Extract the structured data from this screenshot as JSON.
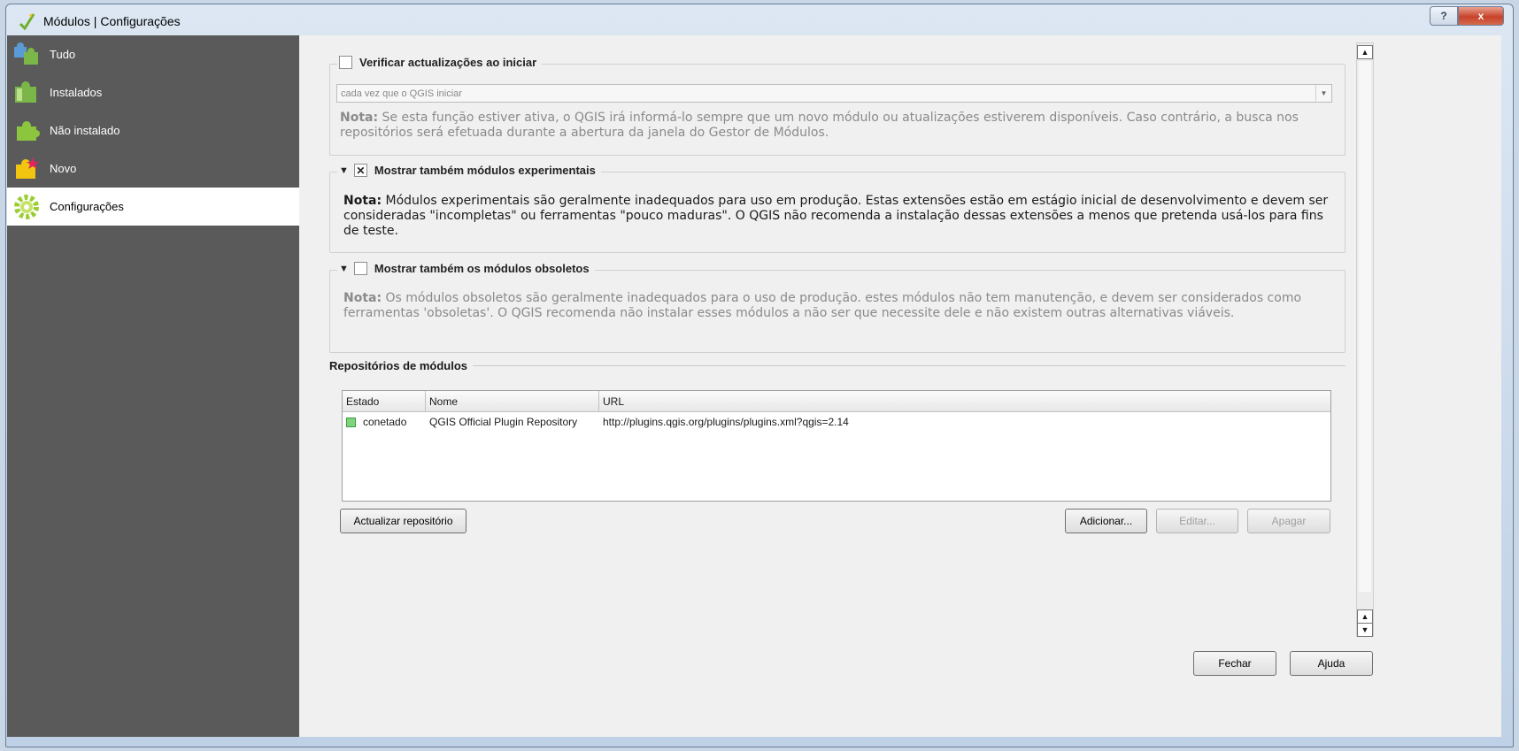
{
  "window": {
    "title": "Módulos | Configurações",
    "help_label": "?",
    "close_label": "x"
  },
  "sidebar": {
    "items": [
      {
        "label": "Tudo",
        "icon": "puzzle-all-icon"
      },
      {
        "label": "Instalados",
        "icon": "puzzle-installed-icon"
      },
      {
        "label": "Não instalado",
        "icon": "puzzle-not-installed-icon"
      },
      {
        "label": "Novo",
        "icon": "puzzle-new-icon"
      },
      {
        "label": "Configurações",
        "icon": "gear-icon",
        "active": true
      }
    ]
  },
  "updates": {
    "checkbox_label": "Verificar actualizações ao iniciar",
    "checked": false,
    "frequency": "cada vez que o QGIS iniciar",
    "note_label": "Nota:",
    "note_text": " Se esta função estiver ativa, o QGIS irá informá-lo sempre que um novo módulo ou atualizações estiverem disponíveis. Caso contrário, a busca nos repositórios será efetuada durante a abertura da janela do Gestor de Módulos."
  },
  "experimental": {
    "checkbox_label": "Mostrar também módulos experimentais",
    "checked": true,
    "note_label": "Nota:",
    "note_text": " Módulos experimentais são geralmente inadequados para uso em produção. Estas extensões estão em estágio inicial de desenvolvimento e devem ser consideradas  \"incompletas\" ou ferramentas \"pouco maduras\". O QGIS não recomenda a instalação dessas extensões a menos que pretenda usá-los para fins de teste."
  },
  "deprecated": {
    "checkbox_label": "Mostrar também os módulos obsoletos",
    "checked": false,
    "note_label": "Nota:",
    "note_text": " Os módulos obsoletos são geralmente inadequados para o uso de produção. estes módulos não tem manutenção, e devem ser considerados como ferramentas 'obsoletas'. O QGIS recomenda não instalar esses módulos a não ser que necessite dele e não existem outras alternativas viáveis."
  },
  "repositories": {
    "section_title": "Repositórios de módulos",
    "columns": [
      "Estado",
      "Nome",
      "URL"
    ],
    "rows": [
      {
        "status": "conetado",
        "name": "QGIS Official Plugin Repository",
        "url": "http://plugins.qgis.org/plugins/plugins.xml?qgis=2.14"
      }
    ],
    "reload_button": "Actualizar repositório",
    "add_button": "Adicionar...",
    "edit_button": "Editar...",
    "delete_button": "Apagar"
  },
  "footer": {
    "close_button": "Fechar",
    "help_button": "Ajuda"
  },
  "colors": {
    "sidebar_bg": "#5a5a5a",
    "status_connected": "#7fd57f"
  }
}
